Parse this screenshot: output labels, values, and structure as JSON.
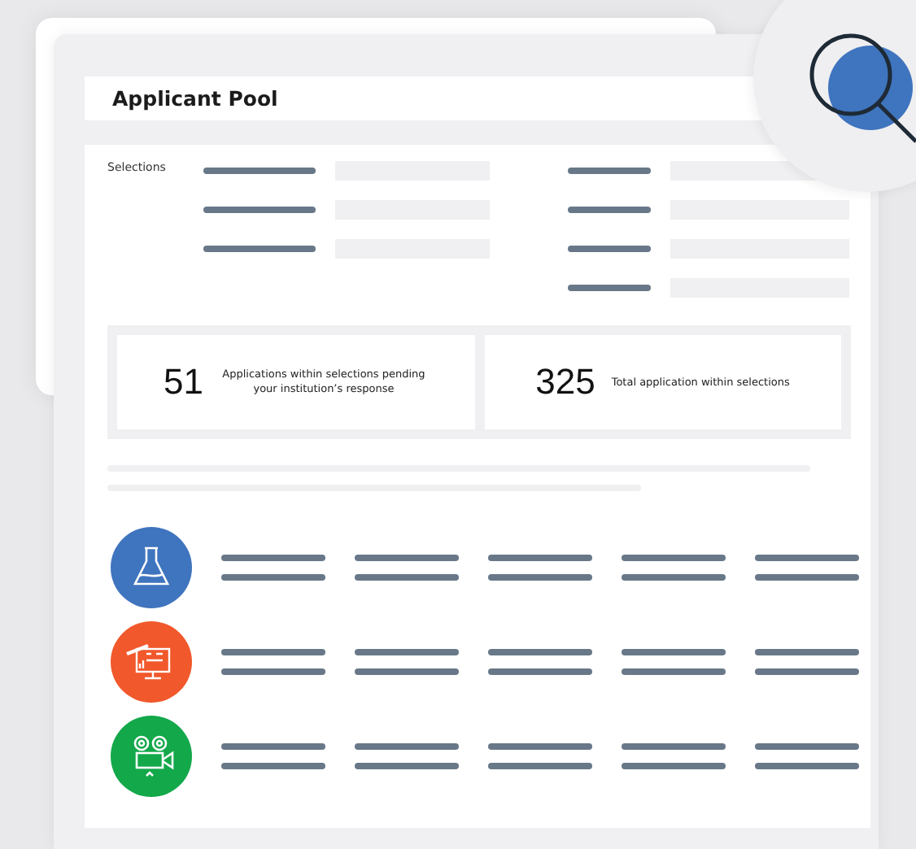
{
  "panel": {
    "title": "Applicant Pool"
  },
  "selections": {
    "label": "Selections"
  },
  "stats": [
    {
      "value": "51",
      "text": "Applications within selections pending your institution’s response"
    },
    {
      "value": "325",
      "text": "Total application within selections"
    }
  ],
  "categories": [
    {
      "kind": "flask",
      "color": "#3f74be"
    },
    {
      "kind": "dashboard",
      "color": "#f1582b"
    },
    {
      "kind": "camera",
      "color": "#13a84a"
    }
  ]
}
